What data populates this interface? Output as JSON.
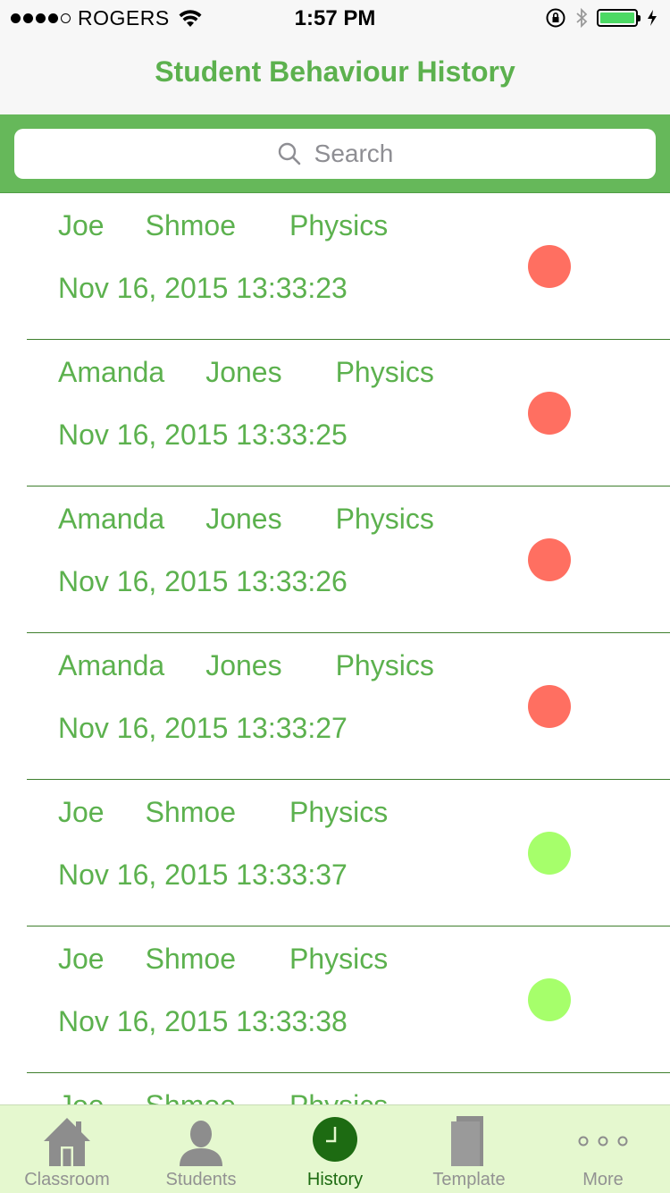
{
  "status_bar": {
    "carrier": "ROGERS",
    "time": "1:57 PM"
  },
  "nav": {
    "title": "Student Behaviour History"
  },
  "search": {
    "placeholder": "Search"
  },
  "rows": [
    {
      "first": "Joe",
      "last": "Shmoe",
      "subject": "Physics",
      "timestamp": "Nov 16, 2015 13:33:23",
      "status": "red"
    },
    {
      "first": "Amanda",
      "last": "Jones",
      "subject": "Physics",
      "timestamp": "Nov 16, 2015 13:33:25",
      "status": "red"
    },
    {
      "first": "Amanda",
      "last": "Jones",
      "subject": "Physics",
      "timestamp": "Nov 16, 2015 13:33:26",
      "status": "red"
    },
    {
      "first": "Amanda",
      "last": "Jones",
      "subject": "Physics",
      "timestamp": "Nov 16, 2015 13:33:27",
      "status": "red"
    },
    {
      "first": "Joe",
      "last": "Shmoe",
      "subject": "Physics",
      "timestamp": "Nov 16, 2015 13:33:37",
      "status": "green"
    },
    {
      "first": "Joe",
      "last": "Shmoe",
      "subject": "Physics",
      "timestamp": "Nov 16, 2015 13:33:38",
      "status": "green"
    },
    {
      "first": "Joe",
      "last": "Shmoe",
      "subject": "Physics",
      "timestamp": "",
      "status": ""
    }
  ],
  "colors": {
    "red": "#ff6f61",
    "green": "#a6ff6b",
    "accent": "#5cb14e"
  },
  "tabs": [
    {
      "label": "Classroom",
      "icon": "house-icon"
    },
    {
      "label": "Students",
      "icon": "person-icon"
    },
    {
      "label": "History",
      "icon": "clock-icon",
      "active": true
    },
    {
      "label": "Template",
      "icon": "document-icon"
    },
    {
      "label": "More",
      "icon": "more-icon"
    }
  ]
}
